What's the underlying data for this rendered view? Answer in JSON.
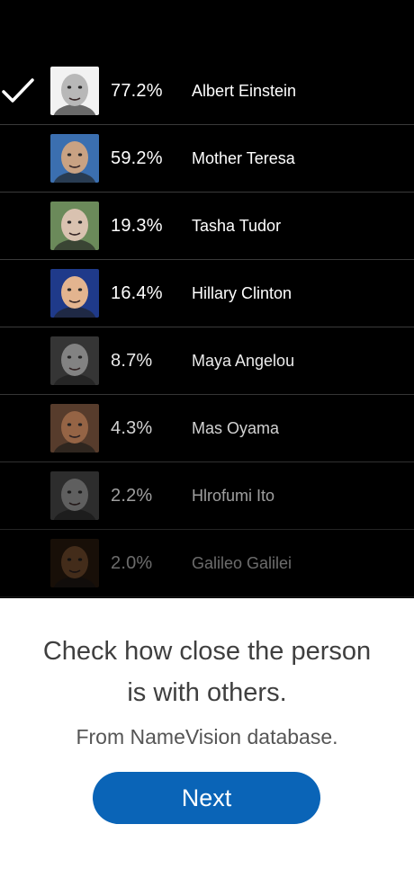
{
  "list": {
    "rows": [
      {
        "percent": "77.2%",
        "name": "Albert Einstein",
        "selected": true,
        "opacity": 1.0,
        "photo": "einstein-portrait",
        "tone": "#b8b8b8",
        "bg": "#f2f2f2"
      },
      {
        "percent": "59.2%",
        "name": "Mother Teresa",
        "selected": false,
        "opacity": 1.0,
        "photo": "teresa-portrait",
        "tone": "#c9a283",
        "bg": "#3b6fb0"
      },
      {
        "percent": "19.3%",
        "name": "Tasha Tudor",
        "selected": false,
        "opacity": 1.0,
        "photo": "tudor-portrait",
        "tone": "#d9c2b0",
        "bg": "#6b8a5a"
      },
      {
        "percent": "16.4%",
        "name": "Hillary Clinton",
        "selected": false,
        "opacity": 1.0,
        "photo": "clinton-portrait",
        "tone": "#e3b48f",
        "bg": "#1f3a8a"
      },
      {
        "percent": "8.7%",
        "name": "Maya Angelou",
        "selected": false,
        "opacity": 0.92,
        "photo": "angelou-portrait",
        "tone": "#8e8e8e",
        "bg": "#3a3a3a"
      },
      {
        "percent": "4.3%",
        "name": "Mas Oyama",
        "selected": false,
        "opacity": 0.82,
        "photo": "oyama-portrait",
        "tone": "#b67b55",
        "bg": "#6b4a36"
      },
      {
        "percent": "2.2%",
        "name": "Hlrofumi Ito",
        "selected": false,
        "opacity": 0.62,
        "photo": "ito-portrait",
        "tone": "#9a9a9a",
        "bg": "#4a4a4a"
      },
      {
        "percent": "2.0%",
        "name": "Galileo Galilei",
        "selected": false,
        "opacity": 0.42,
        "photo": "galilei-portrait",
        "tone": "#a06a3e",
        "bg": "#3a2414"
      }
    ]
  },
  "caption": {
    "line1": "Check how close the person",
    "line2": "is with others.",
    "sub": "From NameVision database."
  },
  "next_button": {
    "label": "Next"
  },
  "colors": {
    "accent": "#0a64b7",
    "panel": "#000000"
  }
}
